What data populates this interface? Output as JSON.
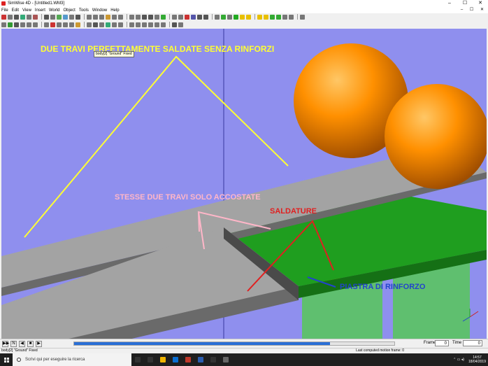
{
  "window": {
    "title": "SimWise 4D - [Untitled1.WM3]",
    "controls": [
      "–",
      "☐",
      "✕"
    ]
  },
  "menu": [
    "File",
    "Edit",
    "View",
    "Insert",
    "World",
    "Object",
    "Tools",
    "Window",
    "Help"
  ],
  "mdi_controls": "– ☐ ✕",
  "toolbar1_colors": [
    "#c33",
    "#777",
    "#555",
    "#3a7",
    "#777",
    "#a55",
    "#555",
    "#777",
    "#5a5",
    "#59c",
    "#777",
    "#555",
    "#777",
    "#777",
    "#777",
    "#c93",
    "#777",
    "#777",
    "#777",
    "#777",
    "#555",
    "#555",
    "#777",
    "#3a3",
    "#777",
    "#777",
    "#c33",
    "#55a",
    "#555",
    "#555",
    "#777",
    "#3a3",
    "#777",
    "#2a2",
    "#e8c000",
    "#e8c000",
    "#e8c000",
    "#e8c000",
    "#3a3",
    "#3a3",
    "#777",
    "#777",
    "#777"
  ],
  "toolbar2_colors": [
    "#777",
    "#393",
    "#555",
    "#777",
    "#777",
    "#777",
    "#777",
    "#c33",
    "#777",
    "#777",
    "#777",
    "#c93",
    "#777",
    "#555",
    "#777",
    "#3a7",
    "#777",
    "#777",
    "#777",
    "#777",
    "#777",
    "#777",
    "#777",
    "#777",
    "#555",
    "#777"
  ],
  "scene_colors": {
    "background": "#8f8fee",
    "beam_top": "#a3a3a3",
    "beam_side": "#6a6a6a",
    "plate_green": "#1f9e1f",
    "plate_green_dark": "#157015",
    "support_green": "#5fbf6f",
    "weld_yellow": "#d4c400",
    "ball_orange": "#ff8a00"
  },
  "annotations": {
    "title": "DUE TRAVI PERFETTAMENTE SALDATE SENZA RINFORZI",
    "side_by_side": "STESSE DUE TRAVI SOLO ACCOSTATE",
    "welds": "SALDATURE",
    "plate": "PIASTRA DI RINFORZO"
  },
  "annotation_colors": {
    "title": "#ffff33",
    "side_by_side": "#ffb6c8",
    "welds": "#e02020",
    "plate": "#2244cc"
  },
  "tooltip": "body[2] \"Ground\" Fixed",
  "sim": {
    "buttons": [
      "▶▶",
      "N",
      "◀",
      "■",
      "▶"
    ],
    "progress": 0.8,
    "frame_label": "Frame",
    "frame_value": "0",
    "time_label": "Time",
    "time_value": "0"
  },
  "status": {
    "left": "body[2] \"Ground\" Fixed",
    "right": "Last computed motion frame: 0"
  },
  "taskbar": {
    "search_placeholder": "Scrivi qui per eseguire la ricerca",
    "apps": [
      "#333",
      "#333",
      "#f0b400",
      "#0a6ed1",
      "#c0392b",
      "#2a5db0",
      "#333",
      "#666"
    ],
    "time": "14:57",
    "date": "18/04/2019"
  }
}
